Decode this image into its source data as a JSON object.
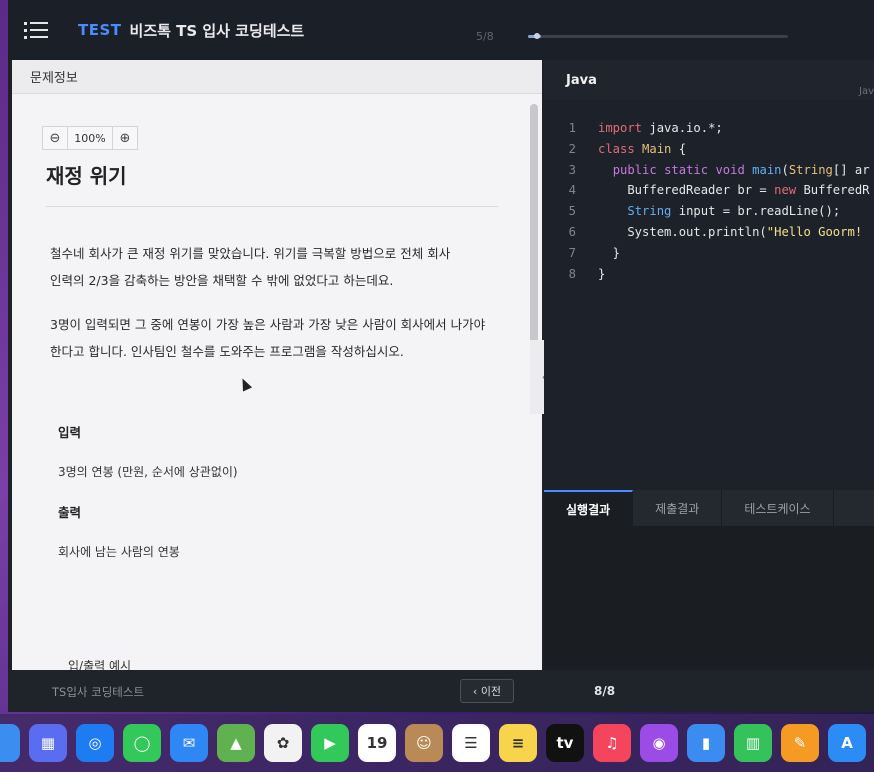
{
  "header": {
    "test_label": "TEST",
    "title": "비즈톡 TS 입사 코딩테스트",
    "progress_text": "5/8",
    "progress_fraction": 0.05
  },
  "problem": {
    "panel_title": "문제정보",
    "zoom": "100%",
    "title": "재정 위기",
    "paragraphs": [
      "철수네 회사가 큰 재정 위기를 맞았습니다. 위기를 극복할 방법으로 전체 회사",
      "인력의 2/3을 감축하는 방안을 채택할 수 밖에 없었다고 하는데요.",
      "3명이 입력되면 그 중에 연봉이 가장 높은 사람과 가장 낮은 사람이 회사에서 나가야",
      "한다고 합니다. 인사팀인 철수를 도와주는 프로그램을 작성하십시오."
    ],
    "input_heading": "입력",
    "input_text": "3명의 연봉 (만원, 순서에 상관없이)",
    "output_heading": "출력",
    "output_text": "회사에 남는 사람의 연봉",
    "example_heading": "입/출력 예시"
  },
  "editor": {
    "language": "Java",
    "language_right": "Jav",
    "line_numbers": [
      "1",
      "2",
      "3",
      "4",
      "5",
      "6",
      "7",
      "8"
    ]
  },
  "results": {
    "tabs": [
      "실행결과",
      "제출결과",
      "테스트케이스"
    ]
  },
  "footer": {
    "brand": "TS입사 코딩테스트",
    "prev_label": "‹ 이전",
    "page": "8/8"
  },
  "dock": {
    "icons": [
      {
        "name": "finder-icon",
        "color": "#3b8df0",
        "glyph": ""
      },
      {
        "name": "launchpad-icon",
        "color": "#5a6cf0",
        "glyph": "▦"
      },
      {
        "name": "safari-icon",
        "color": "#1e7cf2",
        "glyph": "◎"
      },
      {
        "name": "messages-icon",
        "color": "#33c85a",
        "glyph": "◯"
      },
      {
        "name": "mail-icon",
        "color": "#2f86f5",
        "glyph": "✉"
      },
      {
        "name": "maps-icon",
        "color": "#5fb24f",
        "glyph": "▲"
      },
      {
        "name": "photos-icon",
        "color": "#f2f2f2",
        "glyph": "✿"
      },
      {
        "name": "facetime-icon",
        "color": "#33c85a",
        "glyph": "▶"
      },
      {
        "name": "calendar-icon",
        "color": "#ffffff",
        "glyph": "19"
      },
      {
        "name": "contacts-icon",
        "color": "#b98a55",
        "glyph": "☺"
      },
      {
        "name": "reminders-icon",
        "color": "#ffffff",
        "glyph": "☰"
      },
      {
        "name": "notes-icon",
        "color": "#f7d44c",
        "glyph": "≡"
      },
      {
        "name": "apple-tv-icon",
        "color": "#111111",
        "glyph": "tv"
      },
      {
        "name": "music-icon",
        "color": "#f5455c",
        "glyph": "♫"
      },
      {
        "name": "podcasts-icon",
        "color": "#9b4ce6",
        "glyph": "◉"
      },
      {
        "name": "keynote-icon",
        "color": "#3a8cf0",
        "glyph": "▮"
      },
      {
        "name": "numbers-icon",
        "color": "#34c35a",
        "glyph": "▥"
      },
      {
        "name": "pages-icon",
        "color": "#f59a23",
        "glyph": "✎"
      },
      {
        "name": "app-store-icon",
        "color": "#2c8cf5",
        "glyph": "A"
      }
    ]
  }
}
